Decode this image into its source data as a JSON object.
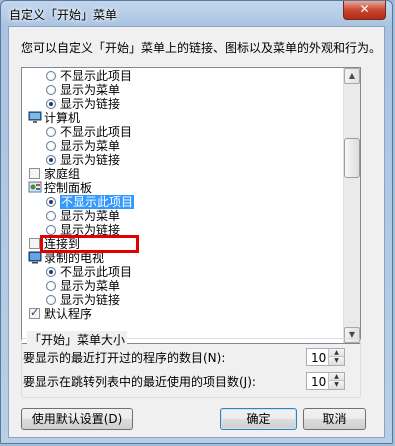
{
  "window": {
    "title": "自定义「开始」菜单",
    "close_glyph": "✕"
  },
  "description": "您可以自定义「开始」菜单上的链接、图标以及菜单的外观和行为。",
  "list": {
    "items": [
      {
        "type": "radio",
        "label": "不显示此项目",
        "checked": false
      },
      {
        "type": "radio",
        "label": "显示为菜单",
        "checked": false
      },
      {
        "type": "radio",
        "label": "显示为链接",
        "checked": true
      },
      {
        "type": "category",
        "label": "计算机",
        "icon": "computer-icon"
      },
      {
        "type": "radio",
        "label": "不显示此项目",
        "checked": false
      },
      {
        "type": "radio",
        "label": "显示为菜单",
        "checked": false
      },
      {
        "type": "radio",
        "label": "显示为链接",
        "checked": true
      },
      {
        "type": "checkbox",
        "label": "家庭组",
        "checked": false
      },
      {
        "type": "category",
        "label": "控制面板",
        "icon": "control-panel-icon"
      },
      {
        "type": "radio",
        "label": "不显示此项目",
        "checked": true,
        "selected": true
      },
      {
        "type": "radio",
        "label": "显示为菜单",
        "checked": false
      },
      {
        "type": "radio",
        "label": "显示为链接",
        "checked": false
      },
      {
        "type": "checkbox",
        "label": "连接到",
        "checked": false
      },
      {
        "type": "category",
        "label": "录制的电视",
        "icon": "tv-icon"
      },
      {
        "type": "radio",
        "label": "不显示此项目",
        "checked": true
      },
      {
        "type": "radio",
        "label": "显示为菜单",
        "checked": false
      },
      {
        "type": "radio",
        "label": "显示为链接",
        "checked": false
      },
      {
        "type": "checkbox",
        "label": "默认程序",
        "checked": true
      }
    ],
    "scroll_up_glyph": "▲",
    "scroll_down_glyph": "▼"
  },
  "menu_size": {
    "title": "「开始」菜单大小",
    "recent_programs_label": "要显示的最近打开过的程序的数目(N):",
    "recent_programs_value": "10",
    "jump_list_label": "要显示在跳转列表中的最近使用的项目数(J):",
    "jump_list_value": "10",
    "spin_up_glyph": "▲",
    "spin_down_glyph": "▼"
  },
  "buttons": {
    "use_defaults": "使用默认设置(D)",
    "ok": "确定",
    "cancel": "取消"
  },
  "colors": {
    "selection": "#3399ff",
    "highlight_box": "#e00000"
  }
}
